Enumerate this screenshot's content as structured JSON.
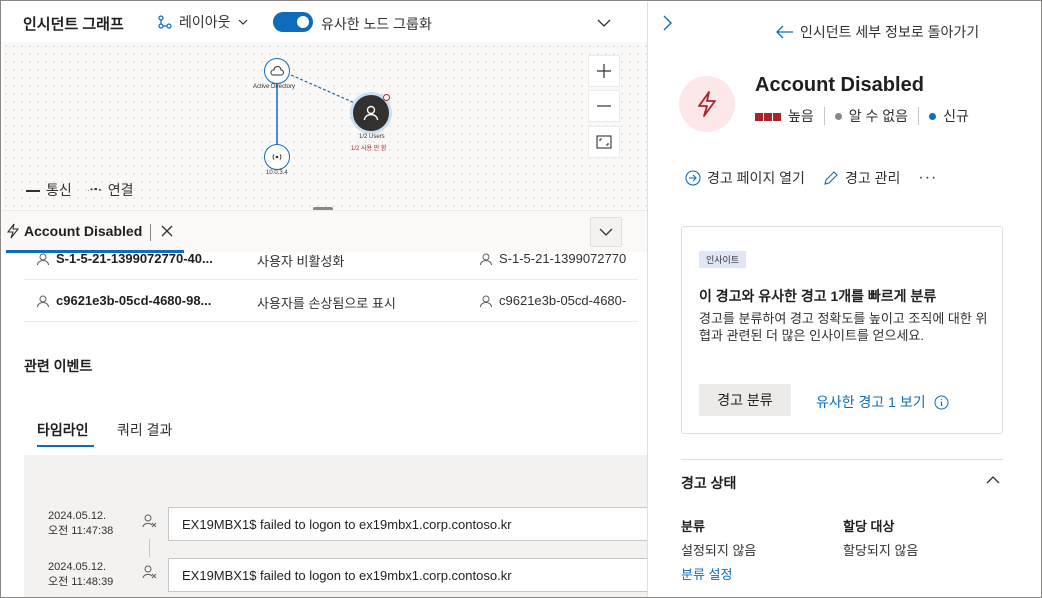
{
  "toolbar": {
    "title": "인시던트 그래프",
    "layout_label": "레이아웃",
    "group_similar_label": "유사한 노드 그룹화",
    "group_similar_on": true
  },
  "graph": {
    "nodes": [
      {
        "label": "Active Directory",
        "icon": "cloud-icon"
      },
      {
        "label": "1/2 Users",
        "sublabel": "1/2 사용 만 함",
        "icon": "user-icon"
      },
      {
        "label": "10.0.3.4",
        "icon": "wifi-icon"
      }
    ],
    "legend": {
      "solid": "통신",
      "dotted": "연결"
    }
  },
  "tab": {
    "label": "Account Disabled"
  },
  "entities": [
    {
      "name": "S-1-5-21-1399072770-40...",
      "action": "사용자 비활성화",
      "target": "S-1-5-21-1399072770"
    },
    {
      "name": "c9621e3b-05cd-4680-98...",
      "action": "사용자를 손상됨으로 표시",
      "target": "c9621e3b-05cd-4680-"
    }
  ],
  "related": {
    "title": "관련 이벤트",
    "tabs": [
      "타임라인",
      "쿼리 결과"
    ]
  },
  "timeline": [
    {
      "date": "2024.05.12.",
      "time": "오전 11:47:38",
      "text": "EX19MBX1$ failed to logon to ex19mbx1.corp.contoso.kr"
    },
    {
      "date": "2024.05.12.",
      "time": "오전 11:48:39",
      "text": "EX19MBX1$ failed to logon to ex19mbx1.corp.contoso.kr"
    }
  ],
  "panel": {
    "back_link": "인시던트 세부 정보로 돌아가기",
    "alert_title": "Account Disabled",
    "severity": "높음",
    "detection_status": "알 수 없음",
    "state": "신규",
    "colors": {
      "severity": "#a4262c",
      "unknown": "#8a8886",
      "new": "#0f6cbd",
      "accent": "#0f6cbd"
    },
    "actions": {
      "open_page": "경고 페이지 열기",
      "manage": "경고 관리",
      "more": "···"
    },
    "insight": {
      "badge": "인사이트",
      "title": "이 경고와 유사한 경고 1개를 빠르게 분류",
      "body": "경고를 분류하여 경고 정확도를 높이고 조직에 대한 위협과 관련된 더 많은 인사이트를 얻으세요.",
      "button": "경고 분류",
      "link": "유사한 경고 1 보기"
    },
    "status": {
      "title": "경고 상태",
      "classification_label": "분류",
      "classification_value": "설정되지 않음",
      "assigned_label": "할당 대상",
      "assigned_value": "할당되지 않음",
      "set_classification": "분류 설정"
    }
  }
}
